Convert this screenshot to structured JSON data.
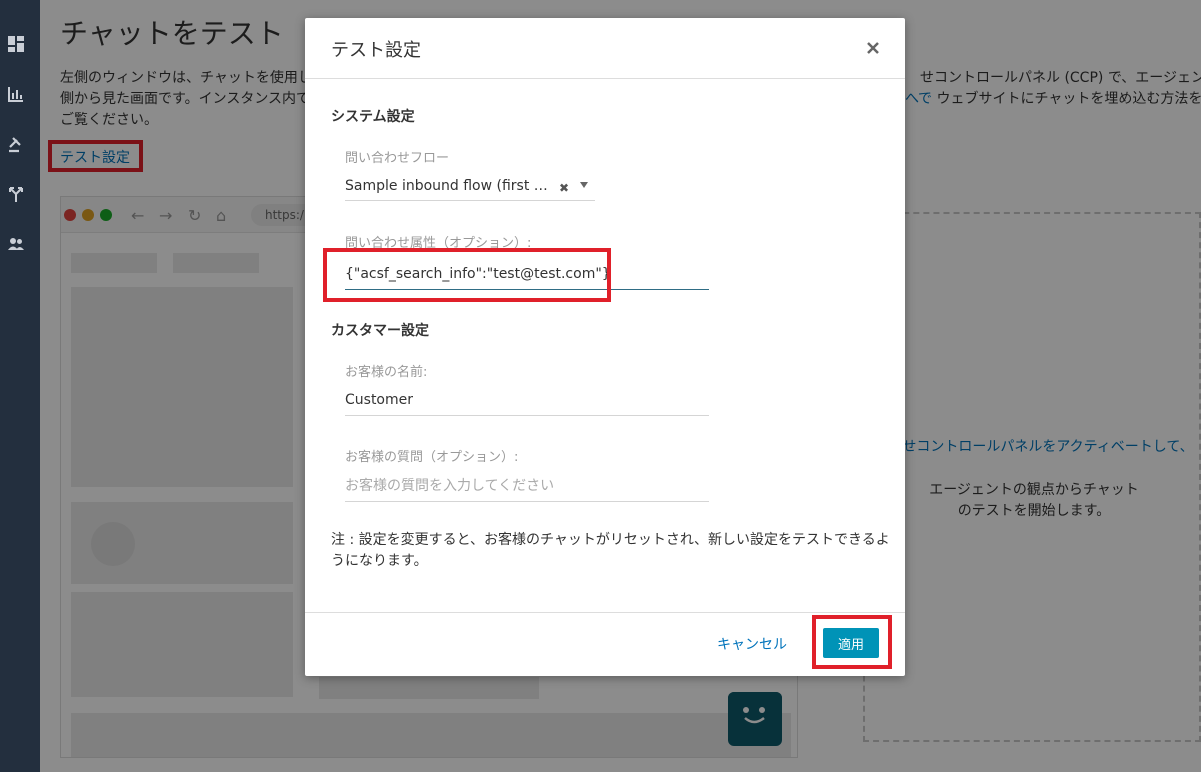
{
  "nav": {
    "icons": [
      "dashboard-icon",
      "metrics-icon",
      "routing-icon",
      "flow-icon",
      "users-icon"
    ]
  },
  "page": {
    "title": "チャットをテスト",
    "desc_line1": "左側のウィンドウは、チャットを使用し",
    "desc_line2": "側から見た画面です。インスタンス内で",
    "desc_line3": "ご覧ください。",
    "desc_right1": "せコントロールパネル (CCP) で、エージェント",
    "desc_right2_link": "へで",
    "desc_right2_text": "ウェブサイトにチャットを埋め込む方法を",
    "test_settings_link": "テスト設定"
  },
  "browser": {
    "url": "https:/"
  },
  "ccp": {
    "link_text": "合わせコントロールパネルをアクティベートして、",
    "body_text": "エージェントの観点からチャットのテストを開始します。"
  },
  "modal": {
    "title": "テスト設定",
    "system_section": "システム設定",
    "contact_flow_label": "問い合わせフロー",
    "contact_flow_value": "Sample inbound flow (first co...",
    "contact_attr_label": "問い合わせ属性（オプション）:",
    "contact_attr_value": "{\"acsf_search_info\":\"test@test.com\"}",
    "customer_section": "カスタマー設定",
    "customer_name_label": "お客様の名前:",
    "customer_name_value": "Customer",
    "customer_question_label": "お客様の質問（オプション）:",
    "customer_question_placeholder": "お客様の質問を入力してください",
    "note": "注 : 設定を変更すると、お客様のチャットがリセットされ、新しい設定をテストできるようになります。",
    "cancel_label": "キャンセル",
    "apply_label": "適用"
  },
  "colors": {
    "accent": "#0093b7",
    "highlight": "#e0202a",
    "link": "#0073bb",
    "sidebar": "#232f3e"
  }
}
